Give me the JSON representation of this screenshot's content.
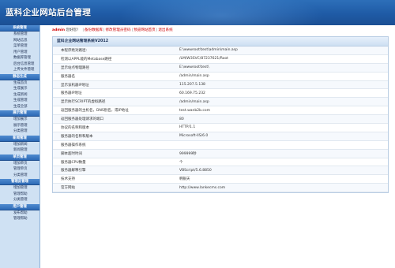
{
  "header": {
    "title": "蓝科企业网站后台管理"
  },
  "sidebar": {
    "groups": [
      {
        "title": "系统管理",
        "items": [
          "系统管理",
          "网站信息",
          "菜单管理",
          "用户管理",
          "数据库管理",
          "后台信息管理",
          "上传文件管理"
        ]
      },
      {
        "title": "静态生成",
        "items": [
          "生成首页",
          "生成展示",
          "生成新闻",
          "生成管理",
          "生成全部"
        ]
      },
      {
        "title": "展示管理",
        "items": [
          "增加展示",
          "展示管理",
          "分类管理"
        ]
      },
      {
        "title": "新闻管理",
        "items": [
          "增加新闻",
          "新闻管理"
        ]
      },
      {
        "title": "单页管理",
        "items": [
          "增加单页",
          "管理单页",
          "分类管理"
        ]
      },
      {
        "title": "管理员管理",
        "items": [
          "增加管理",
          "管理帮助",
          "分类管理"
        ]
      },
      {
        "title": "用户管理",
        "items": [
          "发布帮助",
          "管理帮助"
        ]
      }
    ]
  },
  "topbar": {
    "user": "admin",
    "welcome": " 您好您！ ",
    "links": [
      "备份数据库",
      "修改管理员密码",
      "预览网站首页",
      "退出系统"
    ],
    "separator": "|"
  },
  "panel": {
    "title": "蓝科企业网站管理系统V2012",
    "rows": [
      {
        "key": "本程序绝对路径:",
        "value": "E:\\wwwroot\\test\\admin\\main.asp"
      },
      {
        "key": "检测以APPL能的Metabase路径",
        "value": "/LM/W3SVC/87237621/Root"
      },
      {
        "key": "显示站点物理路径",
        "value": "E:\\wwwroot\\test\\"
      },
      {
        "key": "服务器名",
        "value": "/admin/main.asp"
      },
      {
        "key": "显示该机器IP地址",
        "value": "115.207.5.138"
      },
      {
        "key": "服务器IP地址",
        "value": "60.169.75.232"
      },
      {
        "key": "显示执行SCRIPT的虚拟路径",
        "value": "/admin/main.asp"
      },
      {
        "key": "返回服务器的主机名，DNS别名，或IP地址",
        "value": "test.wanb2b.com"
      },
      {
        "key": "返回服务器处理请求的端口",
        "value": "80"
      },
      {
        "key": "协议的名称和版本",
        "value": "HTTP/1.1"
      },
      {
        "key": "服务器的名称和版本",
        "value": "Microsoft-IIS/6.0"
      },
      {
        "key": "服务器操作系统",
        "value": ""
      },
      {
        "key": "脚本超时时间",
        "value": "999999秒"
      },
      {
        "key": "服务器CPU数量",
        "value": "个"
      },
      {
        "key": "服务器解释引擎",
        "value": "VBScript/5.6.8850"
      },
      {
        "key": "技术支持",
        "value": "韩银天"
      },
      {
        "key": "官方网站",
        "value": "http://www.lankecms.com"
      }
    ]
  }
}
